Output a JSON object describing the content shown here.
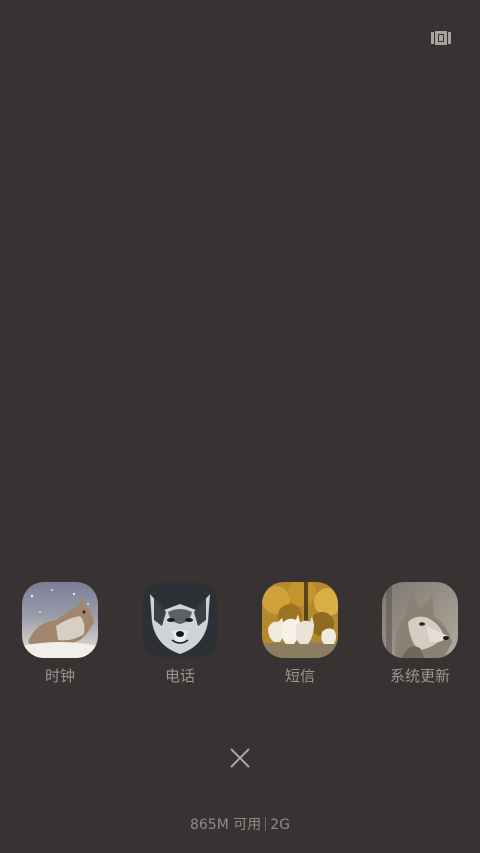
{
  "header": {
    "icon": "recent-apps-grid-icon"
  },
  "apps": [
    {
      "label": "时钟",
      "icon": "wolf-snow-icon"
    },
    {
      "label": "电话",
      "icon": "wolf-portrait-icon"
    },
    {
      "label": "短信",
      "icon": "wolf-pack-autumn-icon"
    },
    {
      "label": "系统更新",
      "icon": "wolf-gray-icon"
    }
  ],
  "footer": {
    "close_icon": "close-icon",
    "memory_available": "865M 可用",
    "memory_total": "2G"
  },
  "colors": {
    "background": "#383332",
    "text": "#9b9592"
  }
}
